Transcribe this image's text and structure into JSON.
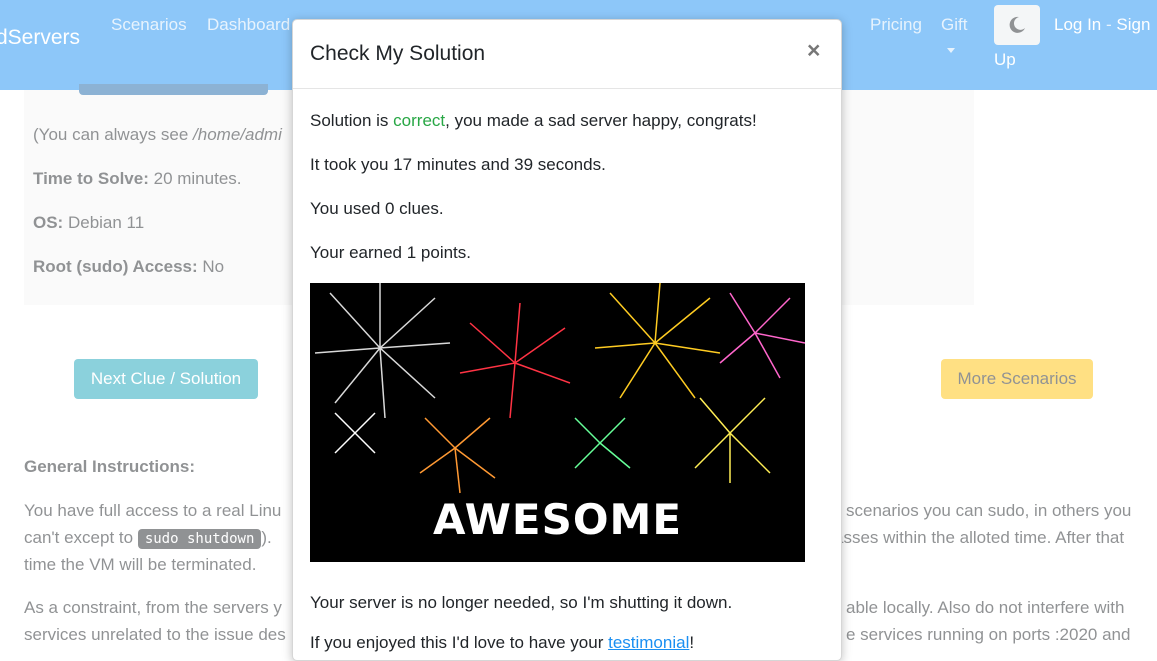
{
  "navbar": {
    "brand": "dServers",
    "links": [
      "Scenarios",
      "Dashboard",
      "Pricing",
      "Gift"
    ],
    "auth_login": "Log In",
    "auth_sep": "-",
    "auth_sign": "Sign",
    "auth_up": "Up",
    "theme_icon": "moon-icon"
  },
  "panel": {
    "path_line_prefix": "(You can always see ",
    "path_line_path": "/home/admi",
    "time_label": "Time to Solve:",
    "time_value": " 20 minutes.",
    "os_label": "OS:",
    "os_value": " Debian 11",
    "root_label": "Root (sudo) Access:",
    "root_value": " No"
  },
  "buttons": {
    "clue": "Next Clue / Solution",
    "more": "More Scenarios"
  },
  "general": {
    "title": "General Instructions:",
    "p1_start": "You have full access to a real Linu",
    "p1_right": "scenarios you can sudo, in others you",
    "p1_line2_start": "can't except to ",
    "p1_code": "sudo shutdown",
    "p1_line2_end": ").",
    "p1_line2_right": "asses within the alloted time. After that",
    "p1_line3": "time the VM will be terminated.",
    "p2_start": "As a constraint, from the servers y",
    "p2_right": "able locally. Also do not interfere with",
    "p2_line2_start": "services unrelated to the issue des",
    "p2_line2_right": "e services running on ports :2020 and"
  },
  "modal": {
    "title": "Check My Solution",
    "close": "×",
    "solution_prefix": "Solution is ",
    "solution_status": "correct",
    "solution_suffix": ", you made a sad server happy, congrats!",
    "time_taken": "It took you 17 minutes and 39 seconds.",
    "clues_used": "You used 0 clues.",
    "points": "Your earned 1 points.",
    "image_text": "AWESOME",
    "shutdown": "Your server is no longer needed, so I'm shutting it down.",
    "testimonial_prefix": "If you enjoyed this I'd love to have your ",
    "testimonial_link": "testimonial",
    "testimonial_suffix": "!"
  },
  "colors": {
    "navbar": "#1a8ff2",
    "clue_button": "#17a2b8",
    "more_button": "#ffc107",
    "correct": "#28a745"
  }
}
